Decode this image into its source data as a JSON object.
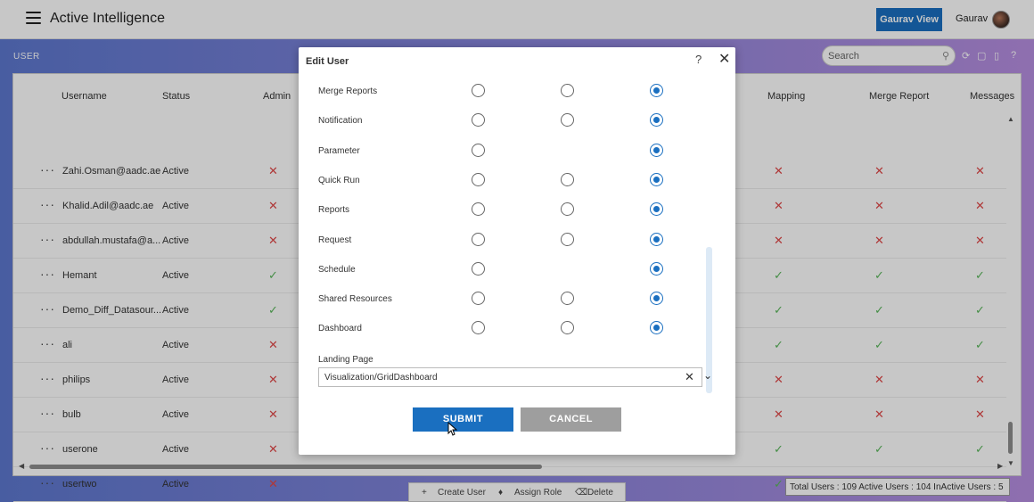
{
  "header": {
    "app_title": "Active Intelligence",
    "view_button": "Gaurav View",
    "user_name": "Gaurav"
  },
  "section": {
    "label": "USER"
  },
  "search": {
    "placeholder": "Search"
  },
  "table": {
    "columns": [
      "Username",
      "Status",
      "Admin",
      "Mapping",
      "Merge Report",
      "Messages"
    ],
    "rows": [
      {
        "username": "Zahi.Osman@aadc.ae",
        "status": "Active",
        "admin": "x",
        "mapping": "x",
        "merge_report": "x",
        "messages": "x"
      },
      {
        "username": "Khalid.Adil@aadc.ae",
        "status": "Active",
        "admin": "x",
        "mapping": "x",
        "merge_report": "x",
        "messages": "x"
      },
      {
        "username": "abdullah.mustafa@a...",
        "status": "Active",
        "admin": "x",
        "mapping": "x",
        "merge_report": "x",
        "messages": "x"
      },
      {
        "username": "Hemant",
        "status": "Active",
        "admin": "v",
        "mapping": "v",
        "merge_report": "v",
        "messages": "v"
      },
      {
        "username": "Demo_Diff_Datasour...",
        "status": "Active",
        "admin": "v",
        "mapping": "v",
        "merge_report": "v",
        "messages": "v"
      },
      {
        "username": "ali",
        "status": "Active",
        "admin": "x",
        "mapping": "v",
        "merge_report": "v",
        "messages": "v"
      },
      {
        "username": "philips",
        "status": "Active",
        "admin": "x",
        "mapping": "x",
        "merge_report": "x",
        "messages": "x"
      },
      {
        "username": "bulb",
        "status": "Active",
        "admin": "x",
        "mapping": "x",
        "merge_report": "x",
        "messages": "x"
      },
      {
        "username": "userone",
        "status": "Active",
        "admin": "x",
        "mapping": "v",
        "merge_report": "v",
        "messages": "v"
      },
      {
        "username": "usertwo",
        "status": "Active",
        "admin": "x",
        "mapping": "v",
        "merge_report": "v",
        "messages": "v"
      }
    ]
  },
  "actions": {
    "create": "Create User",
    "assign": "Assign Role",
    "delete": "Delete"
  },
  "stats": {
    "text": "Total Users : 109  Active Users : 104  InActive Users : 5"
  },
  "modal": {
    "title": "Edit User",
    "help": "?",
    "permissions": [
      {
        "label": "Merge Reports",
        "options": 3,
        "selected": 3
      },
      {
        "label": "Notification",
        "options": 3,
        "selected": 3
      },
      {
        "label": "Parameter",
        "options": 2,
        "selected": 3
      },
      {
        "label": "Quick Run",
        "options": 3,
        "selected": 3
      },
      {
        "label": "Reports",
        "options": 3,
        "selected": 3
      },
      {
        "label": "Request",
        "options": 3,
        "selected": 3
      },
      {
        "label": "Schedule",
        "options": 2,
        "selected": 3
      },
      {
        "label": "Shared Resources",
        "options": 3,
        "selected": 3
      },
      {
        "label": "Dashboard",
        "options": 3,
        "selected": 3
      }
    ],
    "landing_label": "Landing Page",
    "landing_value": "Visualization/GridDashboard",
    "submit": "SUBMIT",
    "cancel": "CANCEL"
  },
  "colors": {
    "accent": "#1a6fc0",
    "error": "#e04848",
    "success": "#59b65a"
  }
}
